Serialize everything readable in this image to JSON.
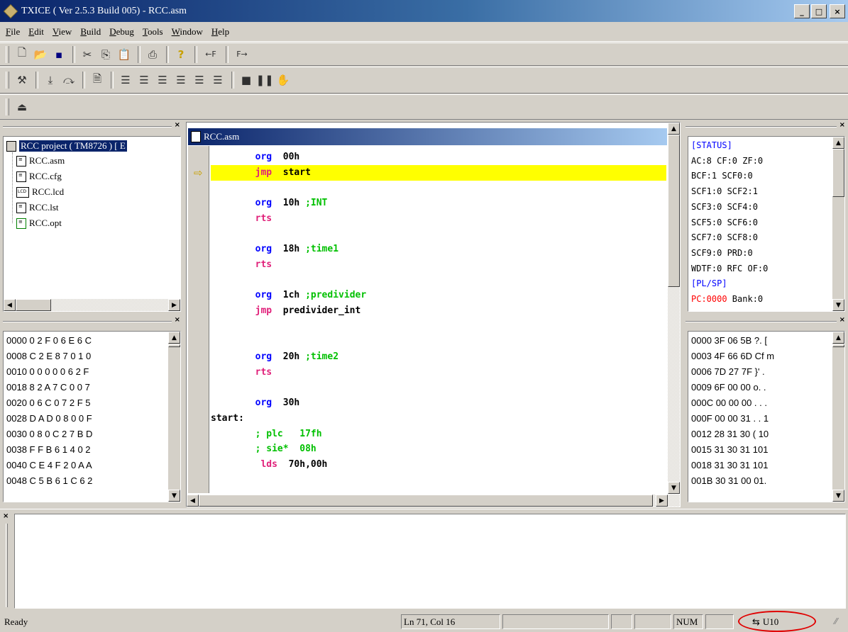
{
  "window": {
    "title": "TXICE ( Ver 2.5.3 Build 005) - RCC.asm",
    "buttons": {
      "minimize": "_",
      "maximize": "□",
      "close": "×"
    }
  },
  "menu": [
    "File",
    "Edit",
    "View",
    "Build",
    "Debug",
    "Tools",
    "Window",
    "Help"
  ],
  "toolbar1": {
    "insert_left": "←F",
    "insert_right": "F→"
  },
  "project_panel": {
    "close": "×",
    "root": "RCC project ( TM8726 ) [ E",
    "files": [
      "RCC.asm",
      "RCC.cfg",
      "RCC.lcd",
      "RCC.lst",
      "RCC.opt"
    ],
    "lcd_badge": "LCD"
  },
  "rom_panel": {
    "close": "×",
    "rows": [
      "0000 0 2 F 0 6 E 6 C",
      "0008 C 2 E 8 7 0 1 0",
      "0010 0 0 0 0 0 6 2 F",
      "0018 8 2 A 7 C 0 0 7",
      "0020 0 6 C 0 7 2 F 5",
      "0028 D A D 0 8 0 0 F",
      "0030 0 8 0 C 2 7 B D",
      "0038 F F B 6 1 4 0 2",
      "0040 C E 4 F 2 0 A A",
      "0048 C 5 B 6 1 C 6 2"
    ]
  },
  "editor": {
    "tab_title": "RCC.asm",
    "lines": [
      {
        "indent": "        ",
        "op": "org",
        "opclass": "kw-blue",
        "arg": "00h",
        "cmt": ""
      },
      {
        "indent": "        ",
        "op": "jmp",
        "opclass": "kw-pink",
        "arg": "start",
        "cmt": ""
      },
      {
        "indent": "",
        "op": "",
        "opclass": "",
        "arg": "",
        "cmt": ""
      },
      {
        "indent": "        ",
        "op": "org",
        "opclass": "kw-blue",
        "arg": "10h",
        "cmt": ";INT"
      },
      {
        "indent": "        ",
        "op": "rts",
        "opclass": "kw-pink",
        "arg": "",
        "cmt": ""
      },
      {
        "indent": "",
        "op": "",
        "opclass": "",
        "arg": "",
        "cmt": ""
      },
      {
        "indent": "        ",
        "op": "org",
        "opclass": "kw-blue",
        "arg": "18h",
        "cmt": ";time1"
      },
      {
        "indent": "        ",
        "op": "rts",
        "opclass": "kw-pink",
        "arg": "",
        "cmt": ""
      },
      {
        "indent": "",
        "op": "",
        "opclass": "",
        "arg": "",
        "cmt": ""
      },
      {
        "indent": "        ",
        "op": "org",
        "opclass": "kw-blue",
        "arg": "1ch",
        "cmt": ";predivider"
      },
      {
        "indent": "        ",
        "op": "jmp",
        "opclass": "kw-pink",
        "arg": "predivider_int",
        "cmt": ""
      },
      {
        "indent": "",
        "op": "",
        "opclass": "",
        "arg": "",
        "cmt": ""
      },
      {
        "indent": "",
        "op": "",
        "opclass": "",
        "arg": "",
        "cmt": ""
      },
      {
        "indent": "        ",
        "op": "org",
        "opclass": "kw-blue",
        "arg": "20h",
        "cmt": ";time2"
      },
      {
        "indent": "        ",
        "op": "rts",
        "opclass": "kw-pink",
        "arg": "",
        "cmt": ""
      },
      {
        "indent": "",
        "op": "",
        "opclass": "",
        "arg": "",
        "cmt": ""
      },
      {
        "indent": "        ",
        "op": "org",
        "opclass": "kw-blue",
        "arg": "30h",
        "cmt": ""
      },
      {
        "indent": "",
        "op": "start:",
        "opclass": "",
        "arg": "",
        "cmt": ""
      },
      {
        "indent": "        ",
        "op": "",
        "opclass": "",
        "arg": "",
        "cmt": "; plc   17fh"
      },
      {
        "indent": "        ",
        "op": "",
        "opclass": "",
        "arg": "",
        "cmt": "; sie*  08h"
      },
      {
        "indent": "         ",
        "op": "lds",
        "opclass": "kw-pink",
        "arg": "70h,00h",
        "cmt": ""
      }
    ],
    "current_line": 1,
    "current_line_color": "#ffff00"
  },
  "register_panel": {
    "close": "×",
    "lines": [
      {
        "text": "[STATUS]",
        "color": "#0000ff"
      },
      {
        "text": "AC:8 CF:0 ZF:0",
        "color": "#000000"
      },
      {
        "text": "BCF:1 SCF0:0",
        "color": "#000000"
      },
      {
        "text": "SCF1:0 SCF2:1",
        "color": "#000000"
      },
      {
        "text": "SCF3:0 SCF4:0",
        "color": "#000000"
      },
      {
        "text": "SCF5:0 SCF6:0",
        "color": "#000000"
      },
      {
        "text": "SCF7:0 SCF8:0",
        "color": "#000000"
      },
      {
        "text": "SCF9:0 PRD:0",
        "color": "#000000"
      },
      {
        "text": "WDTF:0 RFC OF:0",
        "color": "#000000"
      },
      {
        "text": "[PL/SP]",
        "color": "#0000ff"
      }
    ],
    "pc_label": "PC:0000",
    "bank_label": " Bank:0"
  },
  "ram_panel": {
    "close": "×",
    "rows": [
      "0000 3F 06 5B ?. [",
      "0003 4F 66 6D Cf m",
      "0006 7D 27 7F }' .",
      "0009 6F 00 00 o. .",
      "000C 00 00 00 . . .",
      "000F 00 00 31 . . 1",
      "0012 28 31 30 ( 10",
      "0015 31 30 31 101",
      "0018 31 30 31 101",
      "001B 30 31 00 01."
    ]
  },
  "output_panel": {
    "close": "×"
  },
  "status": {
    "ready": "Ready",
    "position": "Ln 71, Col 16",
    "num": "NUM",
    "usb": "U10"
  }
}
